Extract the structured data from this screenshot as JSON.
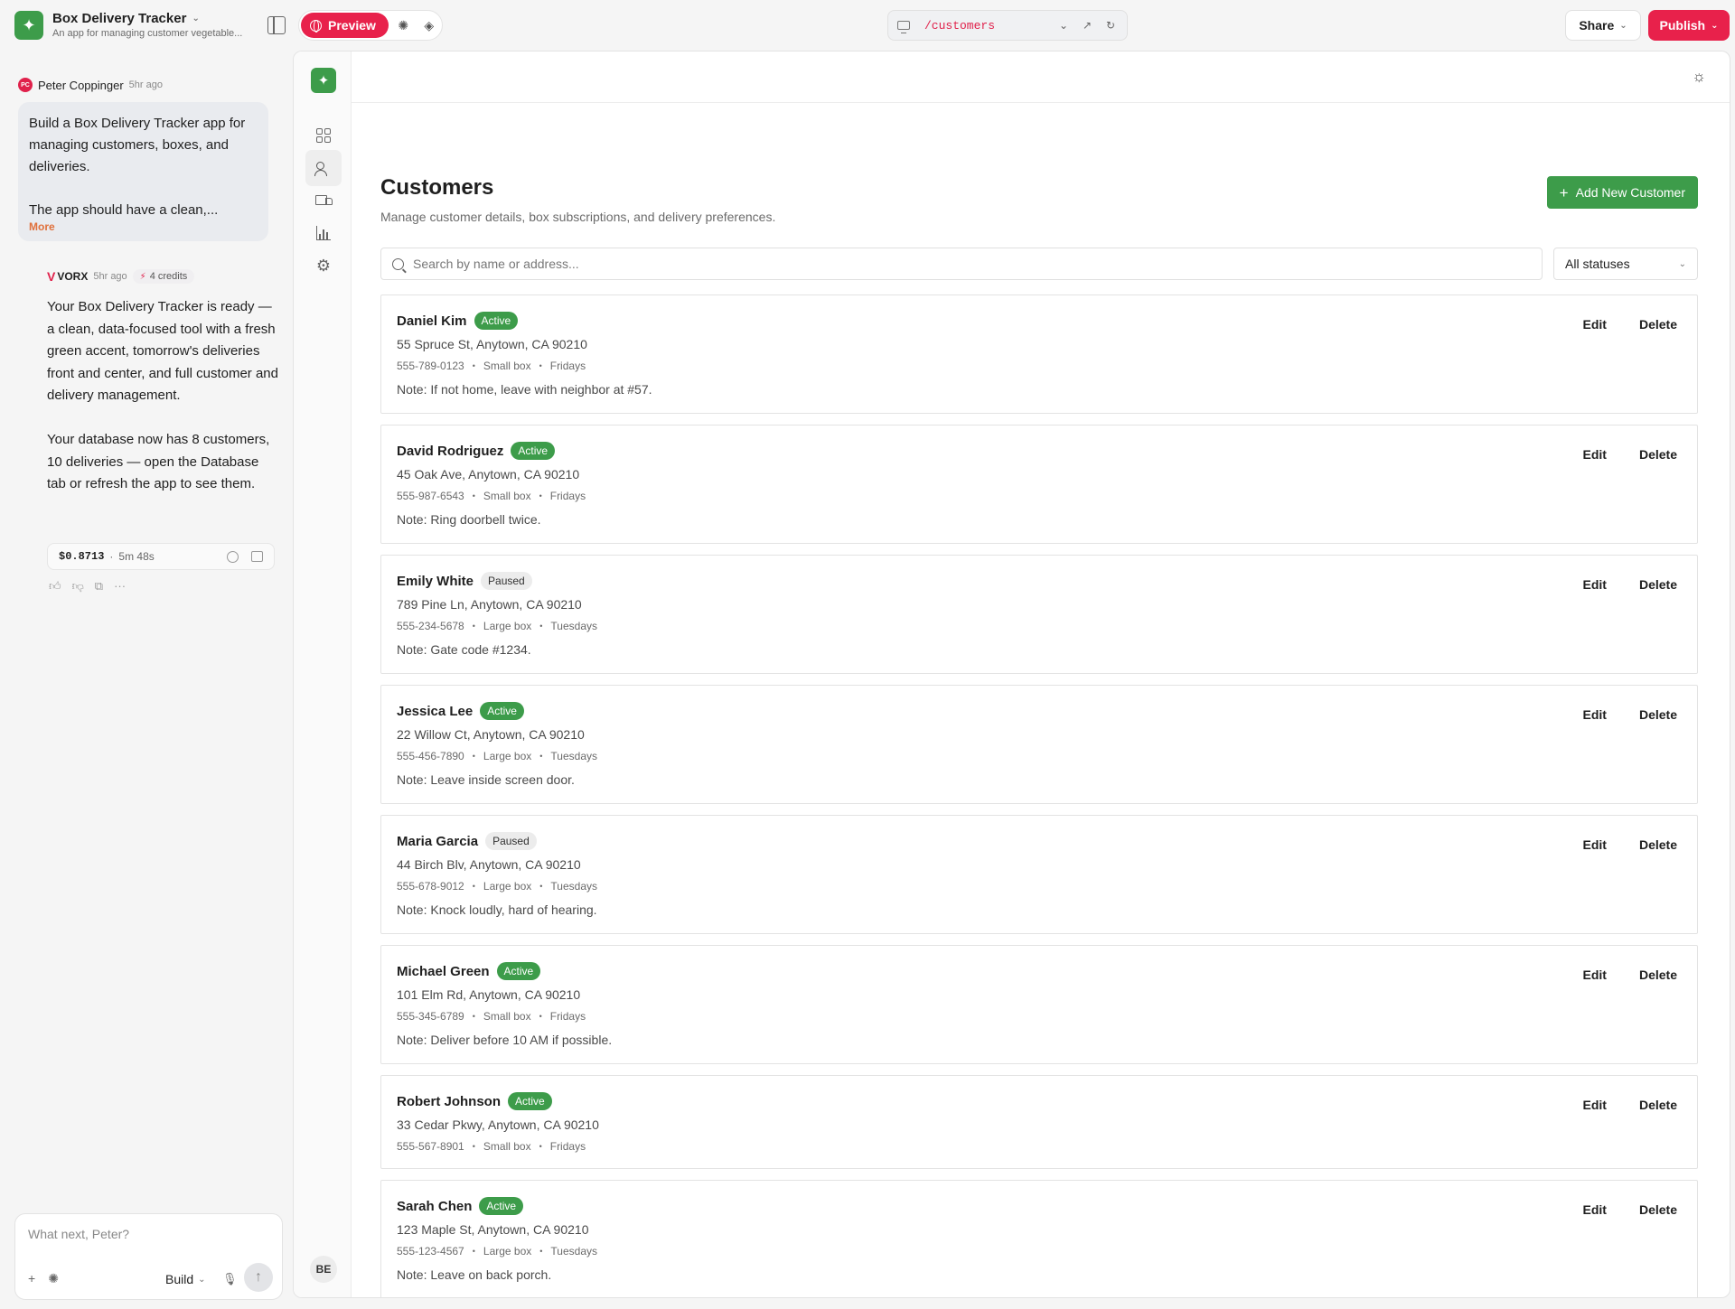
{
  "app": {
    "name": "Box Delivery Tracker",
    "description": "An app for managing customer vegetable..."
  },
  "toolbar": {
    "preview_label": "Preview",
    "url": "/customers",
    "share_label": "Share",
    "publish_label": "Publish"
  },
  "chat": {
    "user": {
      "initials": "PC",
      "name": "Peter Coppinger",
      "time": "5hr ago",
      "message": "Build a Box Delivery Tracker app for managing customers, boxes, and deliveries.\n\nThe app should have a clean,...",
      "more_label": "More"
    },
    "ai": {
      "brand": "VORX",
      "time": "5hr ago",
      "credits": "4 credits",
      "paragraph1": "Your Box Delivery Tracker is ready — a clean, data-focused tool with a fresh green accent, tomorrow's deliveries front and center, and full customer and delivery management.",
      "paragraph2": "Your database now has 8 customers, 10 deliveries — open the Database tab or refresh the app to see them.",
      "cost": "$0.8713",
      "duration": "5m 48s"
    },
    "composer": {
      "placeholder": "What next, Peter?",
      "mode_label": "Build"
    }
  },
  "rail": {
    "user_initials": "BE"
  },
  "page": {
    "title": "Customers",
    "subtitle": "Manage customer details, box subscriptions, and delivery preferences.",
    "add_label": "Add New Customer",
    "search_placeholder": "Search by name or address...",
    "status_filter": "All statuses",
    "edit_label": "Edit",
    "delete_label": "Delete"
  },
  "customers": [
    {
      "name": "Daniel Kim",
      "status": "Active",
      "address": "55 Spruce St, Anytown, CA 90210",
      "phone": "555-789-0123",
      "box": "Small box",
      "day": "Fridays",
      "note": "Note: If not home, leave with neighbor at #57."
    },
    {
      "name": "David Rodriguez",
      "status": "Active",
      "address": "45 Oak Ave, Anytown, CA 90210",
      "phone": "555-987-6543",
      "box": "Small box",
      "day": "Fridays",
      "note": "Note: Ring doorbell twice."
    },
    {
      "name": "Emily White",
      "status": "Paused",
      "address": "789 Pine Ln, Anytown, CA 90210",
      "phone": "555-234-5678",
      "box": "Large box",
      "day": "Tuesdays",
      "note": "Note: Gate code #1234."
    },
    {
      "name": "Jessica Lee",
      "status": "Active",
      "address": "22 Willow Ct, Anytown, CA 90210",
      "phone": "555-456-7890",
      "box": "Large box",
      "day": "Tuesdays",
      "note": "Note: Leave inside screen door."
    },
    {
      "name": "Maria Garcia",
      "status": "Paused",
      "address": "44 Birch Blv, Anytown, CA 90210",
      "phone": "555-678-9012",
      "box": "Large box",
      "day": "Tuesdays",
      "note": "Note: Knock loudly, hard of hearing."
    },
    {
      "name": "Michael Green",
      "status": "Active",
      "address": "101 Elm Rd, Anytown, CA 90210",
      "phone": "555-345-6789",
      "box": "Small box",
      "day": "Fridays",
      "note": "Note: Deliver before 10 AM if possible."
    },
    {
      "name": "Robert Johnson",
      "status": "Active",
      "address": "33 Cedar Pkwy, Anytown, CA 90210",
      "phone": "555-567-8901",
      "box": "Small box",
      "day": "Fridays",
      "note": ""
    },
    {
      "name": "Sarah Chen",
      "status": "Active",
      "address": "123 Maple St, Anytown, CA 90210",
      "phone": "555-123-4567",
      "box": "Large box",
      "day": "Tuesdays",
      "note": "Note: Leave on back porch."
    }
  ]
}
